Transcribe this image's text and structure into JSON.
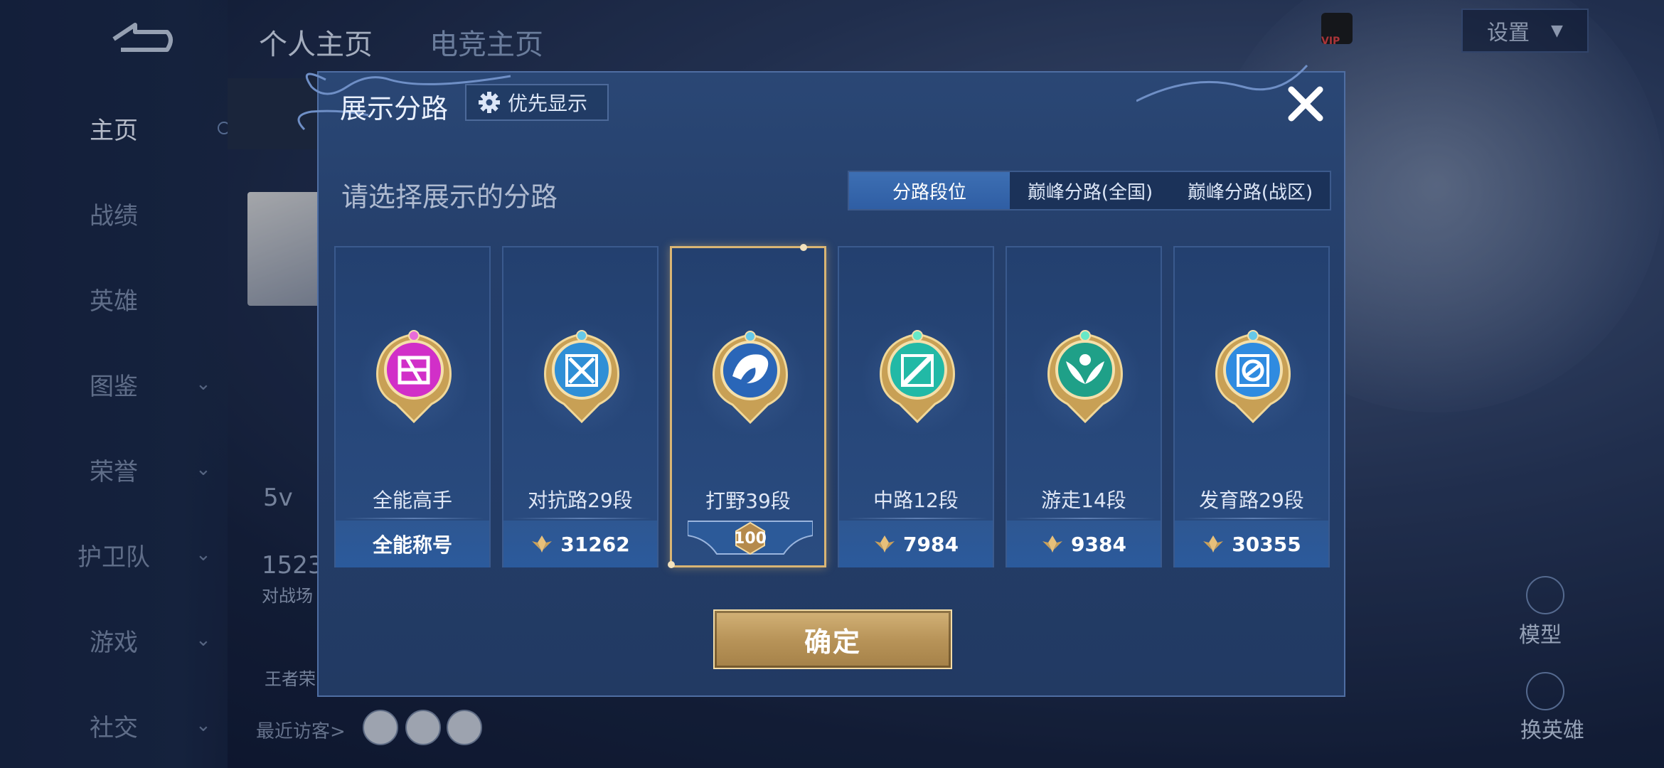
{
  "background": {
    "nav": [
      {
        "label": "主页",
        "active": true,
        "chevron": false
      },
      {
        "label": "战绩",
        "active": false,
        "chevron": false
      },
      {
        "label": "英雄",
        "active": false,
        "chevron": false
      },
      {
        "label": "图鉴",
        "active": false,
        "chevron": true
      },
      {
        "label": "荣誉",
        "active": false,
        "chevron": true
      },
      {
        "label": "护卫队",
        "active": false,
        "chevron": true
      },
      {
        "label": "游戏",
        "active": false,
        "chevron": true
      },
      {
        "label": "社交",
        "active": false,
        "chevron": true
      }
    ],
    "top_tabs": [
      "个人主页",
      "电竞主页"
    ],
    "settings_label": "设置",
    "vip_label": "VIP",
    "stats": {
      "partial_number": "1523",
      "partial_label": "对战场",
      "small": "5v",
      "king": "王者荣"
    },
    "visitors_label": "最近访客>",
    "right_buttons": {
      "model": "模型",
      "change_hero": "换英雄"
    }
  },
  "dialog": {
    "title": "展示分路",
    "priority_button": "优先显示",
    "subtitle": "请选择展示的分路",
    "tabs": [
      {
        "label": "分路段位",
        "active": true
      },
      {
        "label": "巅峰分路(全国)",
        "active": false
      },
      {
        "label": "巅峰分路(战区)",
        "active": false
      }
    ],
    "cards": [
      {
        "name": "全能高手",
        "footer": "全能称号",
        "points": null,
        "emblem_color": "#d12fc8",
        "selected": false
      },
      {
        "name": "对抗路29段",
        "footer": null,
        "points": "31262",
        "emblem_color": "#2f8fd6",
        "selected": false
      },
      {
        "name": "打野39段",
        "footer": null,
        "points": null,
        "badge": "100",
        "emblem_color": "#2a66b8",
        "selected": true
      },
      {
        "name": "中路12段",
        "footer": null,
        "points": "7984",
        "emblem_color": "#22b9a6",
        "selected": false
      },
      {
        "name": "游走14段",
        "footer": null,
        "points": "9384",
        "emblem_color": "#1fa088",
        "selected": false
      },
      {
        "name": "发育路29段",
        "footer": null,
        "points": "30355",
        "emblem_color": "#2f8be0",
        "selected": false
      }
    ],
    "confirm_label": "确定"
  }
}
